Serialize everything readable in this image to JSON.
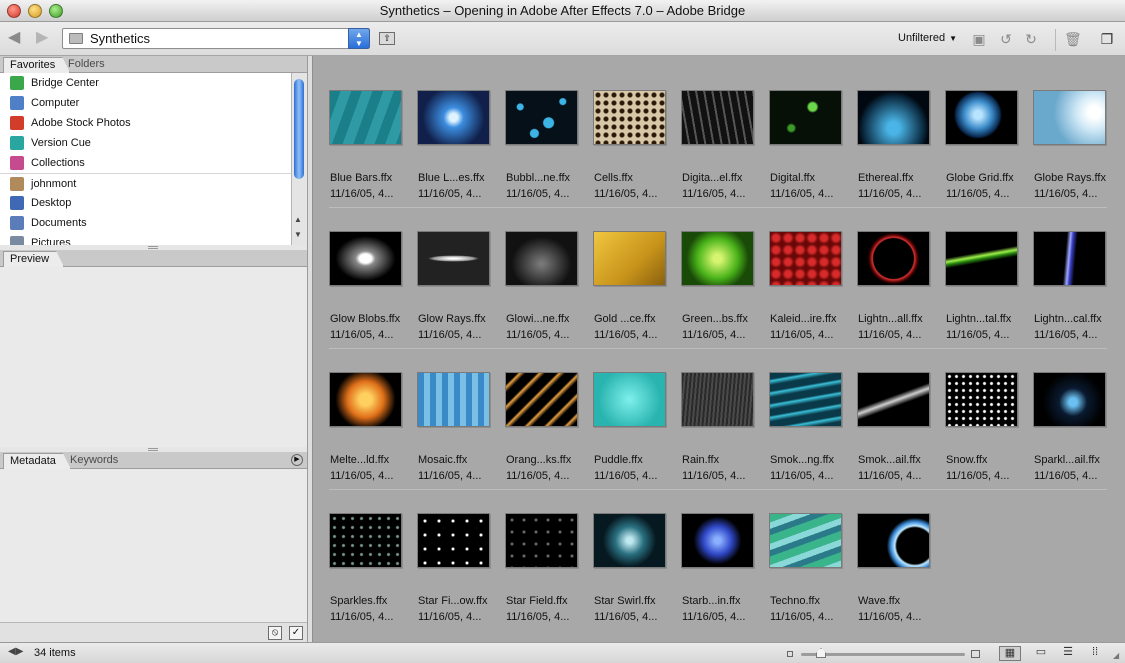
{
  "window": {
    "title": "Synthetics – Opening in Adobe After Effects 7.0 – Adobe Bridge"
  },
  "toolbar": {
    "path": "Synthetics",
    "filter": "Unfiltered",
    "back_icon": "◀",
    "forward_icon": "▶"
  },
  "left_panel": {
    "tabs": [
      "Favorites",
      "Folders"
    ],
    "favorites": [
      {
        "label": "Bridge Center",
        "icon": "bridge-center-icon",
        "color": "#3aa84a"
      },
      {
        "label": "Computer",
        "icon": "computer-icon",
        "color": "#4f7fc6"
      },
      {
        "label": "Adobe Stock Photos",
        "icon": "stock-photos-icon",
        "color": "#d23c2a"
      },
      {
        "label": "Version Cue",
        "icon": "version-cue-icon",
        "color": "#2aa6a0"
      },
      {
        "label": "Collections",
        "icon": "collections-icon",
        "color": "#c54a8e"
      },
      {
        "label": "johnmont",
        "icon": "home-icon",
        "color": "#b08a5a"
      },
      {
        "label": "Desktop",
        "icon": "desktop-icon",
        "color": "#3f69b5"
      },
      {
        "label": "Documents",
        "icon": "documents-icon",
        "color": "#5a7cb8"
      },
      {
        "label": "Pictures",
        "icon": "pictures-icon",
        "color": "#7a8aa0"
      }
    ],
    "preview_tab": "Preview",
    "meta_tabs": [
      "Metadata",
      "Keywords"
    ]
  },
  "items": [
    {
      "name": "Blue Bars.ffx",
      "date": "11/16/05, 4...",
      "bg": "repeating-linear-gradient(110deg,#1b7f8a 0 10px,#2f9aa3 10px 20px)"
    },
    {
      "name": "Blue L...es.ffx",
      "date": "11/16/05, 4...",
      "bg": "radial-gradient(circle,#e0f4ff 0 4px,#3c8de0 10px,#10204a 70%)"
    },
    {
      "name": "Bubbl...ne.ffx",
      "date": "11/16/05, 4...",
      "bg": "radial-gradient(circle at 20% 30%,#3cb4e6 0 3px,transparent 4px),radial-gradient(circle at 60% 60%,#3cb4e6 0 5px,transparent 6px),radial-gradient(circle at 80% 20%,#3cb4e6 0 3px,transparent 4px),radial-gradient(circle at 40% 80%,#3cb4e6 0 4px,transparent 5px),#061018"
    },
    {
      "name": "Cells.ffx",
      "date": "11/16/05, 4...",
      "bg": "radial-gradient(circle,#2a1a0a 0 2px,transparent 3px) 0 0/8px 8px,#d8c8a8"
    },
    {
      "name": "Digita...el.ffx",
      "date": "11/16/05, 4...",
      "bg": "repeating-linear-gradient(80deg,#111 0 6px,#555 6px 8px),#111"
    },
    {
      "name": "Digital.ffx",
      "date": "11/16/05, 4...",
      "bg": "radial-gradient(circle at 60% 30%,#6ad84a 0 4px,transparent 6px),radial-gradient(circle at 30% 70%,#3a9a2a 0 3px,transparent 5px),#061006"
    },
    {
      "name": "Ethereal.ffx",
      "date": "11/16/05, 4...",
      "bg": "radial-gradient(ellipse at 50% 70%,#4ab4e6 0 6px,#0a2a40 30px,#020810 70%)"
    },
    {
      "name": "Globe Grid.ffx",
      "date": "11/16/05, 4...",
      "bg": "radial-gradient(circle at 45% 45%,#b8e4ff 0 4px,#3a8ac8 14px,#0a2a50 22px,#000 24px)"
    },
    {
      "name": "Globe Rays.ffx",
      "date": "11/16/05, 4...",
      "bg": "radial-gradient(circle at 85% 40%,#fff 0 6px,#cfe8f6 18px,#6aa8cc 60%)"
    },
    {
      "name": "Glow Blobs.ffx",
      "date": "11/16/05, 4...",
      "bg": "radial-gradient(ellipse at 50% 50%,#fff 0 6px,#888 10px,#000 30px)"
    },
    {
      "name": "Glow Rays.ffx",
      "date": "11/16/05, 4...",
      "bg": "radial-gradient(ellipse 60% 10% at 50% 50%,#fff 0 4px,#999 20px,#222 60%)"
    },
    {
      "name": "Glowi...ne.ffx",
      "date": "11/16/05, 4...",
      "bg": "radial-gradient(ellipse at 50% 60%,#777 0 2px,#111 30px)"
    },
    {
      "name": "Gold ...ce.ffx",
      "date": "11/16/05, 4...",
      "bg": "linear-gradient(135deg,#f0c640,#c8941a 60%,#8a6010)"
    },
    {
      "name": "Green...bs.ffx",
      "date": "11/16/05, 4...",
      "bg": "radial-gradient(circle at 50% 50%,#d6f470 0 4px,#4ab41a 20px,#1a4a08 70%)"
    },
    {
      "name": "Kaleid...ire.ffx",
      "date": "11/16/05, 4...",
      "bg": "radial-gradient(circle,#d82a2a 0 3px,#6a0808 6px) 0 0/12px 12px"
    },
    {
      "name": "Lightn...all.ffx",
      "date": "11/16/05, 4...",
      "bg": "radial-gradient(circle at 50% 50%,#000 0 20px,#d83030 21px,#400 24px,#000 26px)"
    },
    {
      "name": "Lightn...tal.ffx",
      "date": "11/16/05, 4...",
      "bg": "linear-gradient(170deg,#000 40%,#9ef04a 46%,#2a8a10 50%,#000 56%)"
    },
    {
      "name": "Lightn...cal.ffx",
      "date": "11/16/05, 4...",
      "bg": "linear-gradient(95deg,#000 44%,#a0a8ff 49%,#3a40c8 52%,#000 58%)"
    },
    {
      "name": "Melte...ld.ffx",
      "date": "11/16/05, 4...",
      "bg": "radial-gradient(circle at 50% 50%,#ffd060 0 6px,#e0701a 18px,#000 30px)"
    },
    {
      "name": "Mosaic.ffx",
      "date": "11/16/05, 4...",
      "bg": "linear-gradient(90deg,#3a8ac8 50%,#7ac0e6 50%) 0 0/12px 12px,#3a8ac8"
    },
    {
      "name": "Orang...ks.ffx",
      "date": "11/16/05, 4...",
      "bg": "repeating-linear-gradient(135deg,#000 0 8px,#e8a040 10px,#000 14px)"
    },
    {
      "name": "Puddle.ffx",
      "date": "11/16/05, 4...",
      "bg": "radial-gradient(circle at 50% 50%,#7ef0ec,#2ab4b0 70%)"
    },
    {
      "name": "Rain.ffx",
      "date": "11/16/05, 4...",
      "bg": "repeating-linear-gradient(95deg,#2a2a2a 0 2px,#4a4a4a 2px 4px)"
    },
    {
      "name": "Smok...ng.ffx",
      "date": "11/16/05, 4...",
      "bg": "repeating-linear-gradient(170deg,#0a3a4a 0 6px,#3ac0d8 8px,#0a3a4a 12px)"
    },
    {
      "name": "Smok...ail.ffx",
      "date": "11/16/05, 4...",
      "bg": "linear-gradient(160deg,#000 45%,#cfcfcf 52%,#000 60%)"
    },
    {
      "name": "Snow.ffx",
      "date": "11/16/05, 4...",
      "bg": "radial-gradient(circle,#fff 0 1px,transparent 2px) 0 0/7px 7px,#000"
    },
    {
      "name": "Sparkl...ail.ffx",
      "date": "11/16/05, 4...",
      "bg": "radial-gradient(circle at 55% 55%,#6ac0f0 0 4px,#0a1a30 14px,#000 30px)"
    },
    {
      "name": "Sparkles.ffx",
      "date": "11/16/05, 4...",
      "bg": "radial-gradient(circle,#7a9a8a 0 1px,transparent 2px) 0 0/9px 9px,#000"
    },
    {
      "name": "Star Fi...ow.ffx",
      "date": "11/16/05, 4...",
      "bg": "radial-gradient(circle,#fff 0 1px,transparent 2px) 0 0/14px 14px,#000"
    },
    {
      "name": "Star Field.ffx",
      "date": "11/16/05, 4...",
      "bg": "radial-gradient(circle,#6a6a6a 0 1px,transparent 2px) 0 0/12px 12px,#000"
    },
    {
      "name": "Star Swirl.ffx",
      "date": "11/16/05, 4...",
      "bg": "radial-gradient(circle,#bfe8f0 0 3px,#2a7080 14px,#061820 60%)"
    },
    {
      "name": "Starb...in.ffx",
      "date": "11/16/05, 4...",
      "bg": "radial-gradient(circle,#8ab0ff 0 3px,#3048c8 14px,#000 24px)"
    },
    {
      "name": "Techno.ffx",
      "date": "11/16/05, 4...",
      "bg": "repeating-linear-gradient(160deg,#3ab48a 0 8px,#8ad8d8 8px 14px,#2a7a8a 14px 20px)"
    },
    {
      "name": "Wave.ffx",
      "date": "11/16/05, 4...",
      "bg": "radial-gradient(circle at 80% 60%,#000 0 18px,#bfe8ff 20px,#3a8ad8 24px,#000 28px)"
    }
  ],
  "status": {
    "count": "34 items"
  }
}
